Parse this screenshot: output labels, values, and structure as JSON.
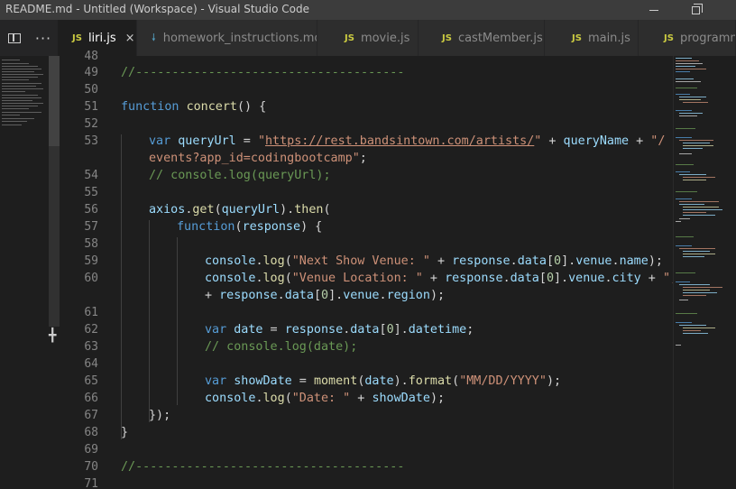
{
  "window": {
    "title": "README.md - Untitled (Workspace) - Visual Studio Code"
  },
  "toolbar": {
    "more_label": "···"
  },
  "tabs": [
    {
      "label": "liri.js",
      "type": "JS",
      "close": "×"
    },
    {
      "label": "homework_instructions.md",
      "type": "MD"
    },
    {
      "label": "movie.js",
      "type": "JS"
    },
    {
      "label": "castMember.js",
      "type": "JS"
    },
    {
      "label": "main.js",
      "type": "JS"
    },
    {
      "label": "programm",
      "type": "JS"
    }
  ],
  "gutter": {
    "line_numbers": [
      "48",
      "49",
      "50",
      "51",
      "52",
      "53",
      "",
      "54",
      "55",
      "56",
      "57",
      "58",
      "59",
      "60",
      "",
      "61",
      "62",
      "63",
      "64",
      "65",
      "66",
      "67",
      "68",
      "69",
      "70",
      "71"
    ]
  },
  "code": {
    "l48": "",
    "l49": "//-------------------------------------",
    "l51_kw": "function",
    "l51_name": "concert",
    "l51_rest": "() {",
    "l53_kw": "var",
    "l53_var": "queryUrl",
    "l53_eq": " = ",
    "l53_q": "\"",
    "l53_url": "https://rest.bandsintown.com/artists/",
    "l53_q2": "\"",
    "l53_plus": " + ",
    "l53_var2": "queryName",
    "l53_plus2": " + ",
    "l53_str2": "\"/",
    "l53b_str": "events?app_id=codingbootcamp\"",
    "l53b_rest": ";",
    "l54": "// console.log(queryUrl);",
    "l56_a": "axios",
    "l56_b": ".",
    "l56_c": "get",
    "l56_d": "(",
    "l56_e": "queryUrl",
    "l56_f": ").",
    "l56_g": "then",
    "l56_h": "(",
    "l57_kw": "function",
    "l57_p": "(",
    "l57_v": "response",
    "l57_r": ") {",
    "l59_a": "console",
    "l59_b": ".",
    "l59_c": "log",
    "l59_d": "(",
    "l59_s": "\"Next Show Venue: \"",
    "l59_e": " + ",
    "l59_v": "response",
    "l59_f": ".",
    "l59_g": "data",
    "l59_h": "[",
    "l59_n": "0",
    "l59_i": "].",
    "l59_j": "venue",
    "l59_k": ".",
    "l59_l": "name",
    "l59_m": ");",
    "l60_a": "console",
    "l60_b": ".",
    "l60_c": "log",
    "l60_d": "(",
    "l60_s": "\"Venue Location: \"",
    "l60_e": " + ",
    "l60_v": "response",
    "l60_f": ".",
    "l60_g": "data",
    "l60_h": "[",
    "l60_n": "0",
    "l60_i": "].",
    "l60_j": "venue",
    "l60_k": ".",
    "l60_l": "city",
    "l60_m": " + ",
    "l60_s2": "\", \"",
    "l60b_a": "+ ",
    "l60b_v": "response",
    "l60b_b": ".",
    "l60b_c": "data",
    "l60b_d": "[",
    "l60b_n": "0",
    "l60b_e": "].",
    "l60b_f": "venue",
    "l60b_g": ".",
    "l60b_h": "region",
    "l60b_i": ");",
    "l62_kw": "var",
    "l62_v": "date",
    "l62_e": " = ",
    "l62_v2": "response",
    "l62_f": ".",
    "l62_g": "data",
    "l62_h": "[",
    "l62_n": "0",
    "l62_i": "].",
    "l62_j": "datetime",
    "l62_k": ";",
    "l63": "// console.log(date);",
    "l65_kw": "var",
    "l65_v": "showDate",
    "l65_e": " = ",
    "l65_fn": "moment",
    "l65_p": "(",
    "l65_v2": "date",
    "l65_r": ").",
    "l65_fn2": "format",
    "l65_p2": "(",
    "l65_s": "\"MM/DD/YYYY\"",
    "l65_r2": ");",
    "l66_a": "console",
    "l66_b": ".",
    "l66_c": "log",
    "l66_d": "(",
    "l66_s": "\"Date: \"",
    "l66_e": " + ",
    "l66_v": "showDate",
    "l66_f": ");",
    "l67": "});",
    "l68": "}",
    "l70": "//-------------------------------------"
  },
  "colors": {
    "keyword": "#569cd6",
    "function": "#dcdcaa",
    "variable": "#9cdcfe",
    "string": "#ce9178",
    "number": "#b5cea8",
    "comment": "#6a9955",
    "editor_bg": "#1e1e1e",
    "titlebar_bg": "#3c3c3c"
  }
}
